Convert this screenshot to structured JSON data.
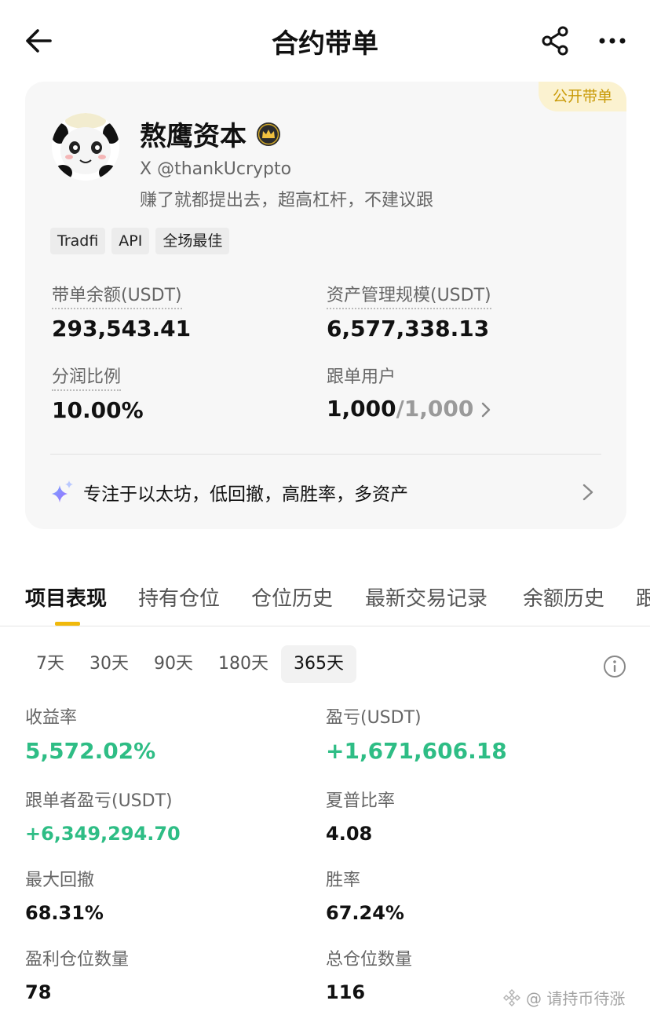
{
  "nav": {
    "title": "合约带单"
  },
  "profile": {
    "badge": "公开带单",
    "name": "熬鹰资本",
    "handle": "X @thankUcrypto",
    "bio": "赚了就都提出去，超高杠杆，不建议跟",
    "tags": [
      "Tradfi",
      "API",
      "全场最佳"
    ],
    "stats": {
      "copy_balance_label": "带单余额(USDT)",
      "copy_balance_value": "293,543.41",
      "aum_label": "资产管理规模(USDT)",
      "aum_value": "6,577,338.13",
      "profit_share_label": "分润比例",
      "profit_share_value": "10.00%",
      "followers_label": "跟单用户",
      "followers_value": "1,000",
      "followers_max": "/1,000"
    },
    "focus_text": "专注于以太坊，低回撤，高胜率，多资产"
  },
  "tabs": [
    {
      "label": "项目表现",
      "active": true
    },
    {
      "label": "持有仓位",
      "active": false
    },
    {
      "label": "仓位历史",
      "active": false
    },
    {
      "label": "最新交易记录",
      "active": false
    },
    {
      "label": "余额历史",
      "active": false
    },
    {
      "label": "跟",
      "active": false
    }
  ],
  "periods": [
    {
      "label": "7天",
      "active": false
    },
    {
      "label": "30天",
      "active": false
    },
    {
      "label": "90天",
      "active": false
    },
    {
      "label": "180天",
      "active": false
    },
    {
      "label": "365天",
      "active": true
    }
  ],
  "metrics": {
    "roi_label": "收益率",
    "roi_value": "5,572.02%",
    "pnl_label": "盈亏(USDT)",
    "pnl_value": "+1,671,606.18",
    "follower_pnl_label": "跟单者盈亏(USDT)",
    "follower_pnl_value": "+6,349,294.70",
    "sharpe_label": "夏普比率",
    "sharpe_value": "4.08",
    "mdd_label": "最大回撤",
    "mdd_value": "68.31%",
    "winrate_label": "胜率",
    "winrate_value": "67.24%",
    "win_positions_label": "盈利仓位数量",
    "win_positions_value": "78",
    "total_positions_label": "总仓位数量",
    "total_positions_value": "116"
  },
  "watermark": "@ 请持币待涨",
  "colors": {
    "accent": "#f0b90b",
    "positive": "#2ebd85",
    "badge_bg": "#fbf2d0",
    "badge_text": "#c99a08"
  },
  "icons": [
    "back-arrow-icon",
    "share-icon",
    "more-icon",
    "crown-icon",
    "sparkle-icon",
    "chevron-right-icon",
    "info-icon",
    "binance-logo-icon"
  ]
}
